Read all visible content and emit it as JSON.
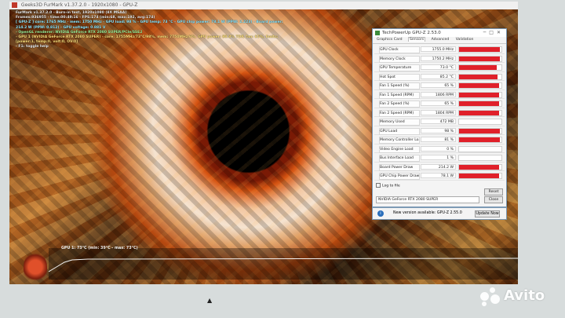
{
  "taskbar_title": "Geeks3D FurMark v1.37.2.0 - 1920x1080 - GPU-Z",
  "osd": {
    "line1": "FurMark v1.37.2.0 - Burn-in test, 1920x1080 (8X MSAA)",
    "line2": "Frames:936955 - time:00:49:16 - FPS:174 (min:68, max:192, avg:174)",
    "line3": "[ GPU-Z ] core: 1765 MHz - mem: 1750 MHz - GPU load: 98 % - GPU temp: 73 °C - GPU chip power: 78.1 W (PPW: 2.223) - Board power: 214.2 W (PPW: 0.812) - GPU voltage: 0.881 V",
    "line4": "- OpenGL renderer: NVIDIA GeForce RTX 2080 SUPER/PCIe/SSE2",
    "line5": "- GPU 1 (NVIDIA GeForce RTX 2080 SUPER) - core: 1755MHz/73°C/98%, mem: 7750MHz/6%, GPU power: 98.8% TDP, fan: 65%, limits:[power:1, temp:0, volt:0, OV:0]",
    "line6": "- F1: toggle help"
  },
  "graph_label": "GPU 1: 73°C (min: 39°C - max: 73°C)",
  "gpuz": {
    "title": "TechPowerUp GPU-Z 2.53.0",
    "tabs": [
      "Graphics Card",
      "Sensors",
      "Advanced",
      "Validation"
    ],
    "active_tab": "Sensors",
    "sensors": [
      {
        "name": "GPU Clock",
        "value": "1755.0 MHz",
        "fill": 0.97
      },
      {
        "name": "Memory Clock",
        "value": "1750.2 MHz",
        "fill": 0.97
      },
      {
        "name": "GPU Temperature",
        "value": "73.0 °C",
        "fill": 0.88
      },
      {
        "name": "Hot Spot",
        "value": "85.2 °C",
        "fill": 0.9
      },
      {
        "name": "Fan 1 Speed (%)",
        "value": "65 %",
        "fill": 0.94
      },
      {
        "name": "Fan 1 Speed (RPM)",
        "value": "1806 RPM",
        "fill": 0.94
      },
      {
        "name": "Fan 2 Speed (%)",
        "value": "65 %",
        "fill": 0.94
      },
      {
        "name": "Fan 2 Speed (RPM)",
        "value": "1804 RPM",
        "fill": 0.94
      },
      {
        "name": "Memory Used",
        "value": "472 MB",
        "fill": 0.0
      },
      {
        "name": "GPU Load",
        "value": "98 %",
        "fill": 0.96
      },
      {
        "name": "Memory Controller Load",
        "value": "81 %",
        "fill": 0.96
      },
      {
        "name": "Video Engine Load",
        "value": "0 %",
        "fill": 0.0
      },
      {
        "name": "Bus Interface Load",
        "value": "1 %",
        "fill": 0.0
      },
      {
        "name": "Board Power Draw",
        "value": "214.2 W",
        "fill": 0.94
      },
      {
        "name": "GPU Chip Power Draw",
        "value": "78.1 W",
        "fill": 0.94
      }
    ],
    "log_label": "Log to file",
    "reset_label": "Reset",
    "selected_gpu": "NVIDIA GeForce RTX 2080 SUPER",
    "close_label": "Close"
  },
  "notification": {
    "icon": "info-icon",
    "message": "New version available: GPU-Z 2.55.0",
    "button": "Update Now"
  },
  "watermark": "Avito"
}
